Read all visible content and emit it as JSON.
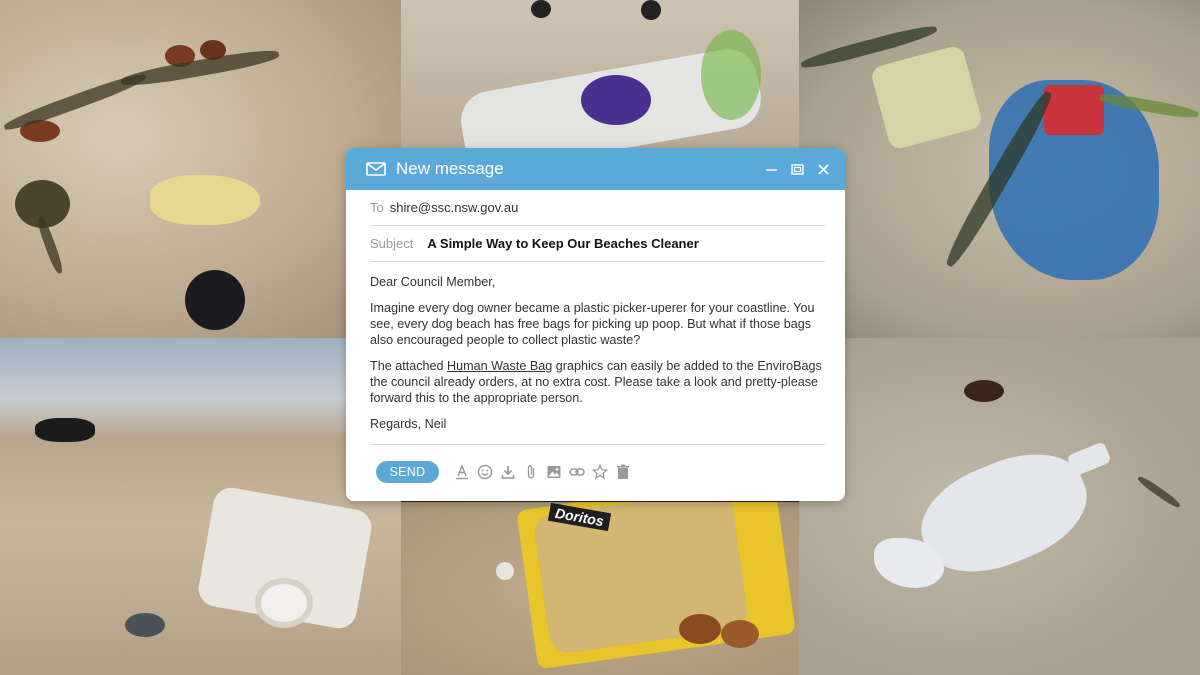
{
  "window": {
    "title": "New message",
    "icons": [
      "mail-icon",
      "minimize-icon",
      "maximize-icon",
      "close-icon"
    ]
  },
  "email": {
    "to_label": "To",
    "to_value": "shire@ssc.nsw.gov.au",
    "subject_label": "Subject",
    "subject_value": "A Simple Way to Keep Our Beaches Cleaner",
    "greeting": "Dear Council Member,",
    "para1": "Imagine every dog owner became a plastic picker-uperer for your coastline. You see, every dog beach has free bags for picking up poop. But what if those bags also encouraged people to collect plastic waste?",
    "para2_before": "The attached ",
    "para2_link": "Human Waste Bag",
    "para2_after": " graphics can easily be added to the EnviroBags the council already orders, at no extra cost. Please take a look and pretty-please forward this to the appropriate person.",
    "signoff": "Regards, Neil"
  },
  "toolbar": {
    "send_label": "SEND",
    "icons": [
      "font-color-icon",
      "emoji-icon",
      "download-icon",
      "attach-icon",
      "image-icon",
      "link-icon",
      "star-icon",
      "trash-icon"
    ]
  },
  "colors": {
    "accent": "#5aa9d8",
    "text": "#333333",
    "muted": "#9a9a9a"
  },
  "collage": {
    "photos": [
      "seaweed-and-toy-photo",
      "plastic-cup-photo",
      "flag-plastic-bag-photo",
      "dog-and-bottle-photo",
      "doritos-packet-photo",
      "fish-sauce-bottle-photo"
    ],
    "doritos_text": "Doritos"
  }
}
